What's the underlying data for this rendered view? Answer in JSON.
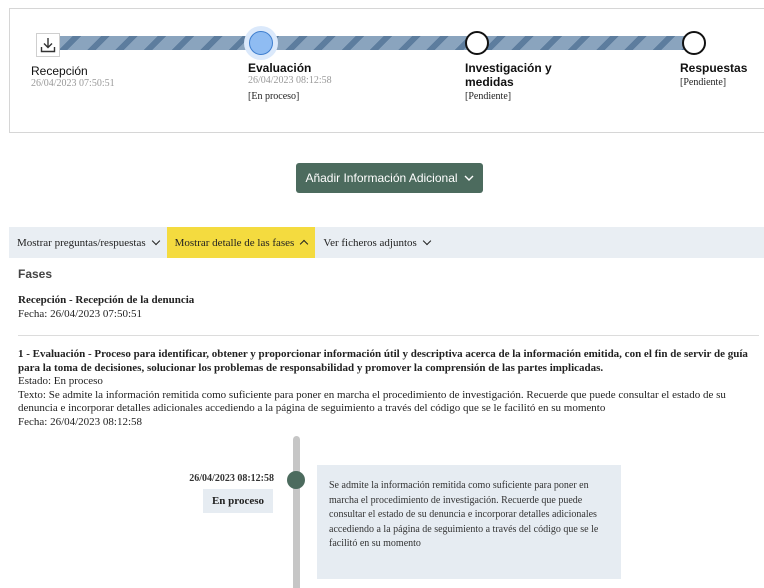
{
  "progress": {
    "steps": [
      {
        "title": "Recepción",
        "date": "26/04/2023 07:50:51",
        "status": ""
      },
      {
        "title": "Evaluación",
        "date": "26/04/2023 08:12:58",
        "status": "[En proceso]"
      },
      {
        "title_line1": "Investigación y",
        "title_line2": "medidas",
        "status": "[Pendiente]"
      },
      {
        "title": "Respuestas",
        "status": "[Pendiente]"
      }
    ],
    "icon": "download-tray-icon",
    "colors": {
      "active": "#8fbcf2",
      "track": "#8aa4be"
    }
  },
  "add_info_button": {
    "label": "Añadir Información Adicional",
    "icon": "chevron-down-icon",
    "color": "#4c6b5e"
  },
  "tabs": [
    {
      "label": "Mostrar preguntas/respuestas",
      "icon": "chevron-down-icon"
    },
    {
      "label": "Mostrar detalle de las fases",
      "icon": "chevron-up-icon",
      "active": true
    },
    {
      "label": "Ver ficheros adjuntos",
      "icon": "chevron-down-icon"
    }
  ],
  "phases": {
    "title": "Fases",
    "reception": {
      "heading": "Recepción - Recepción de la denuncia",
      "date": "Fecha: 26/04/2023 07:50:51"
    },
    "evaluation": {
      "heading": "1 - Evaluación - Proceso para identificar, obtener y proporcionar información útil y descriptiva acerca de la información emitida, con el fin de servir de guía para la toma de decisiones, solucionar los problemas de responsabilidad y promover la comprensión de las partes implicadas.",
      "state": "Estado: En proceso",
      "text": "Texto: Se admite la información remitida como suficiente para poner en marcha el procedimiento de investigación. Recuerde que puede consultar el estado de su denuncia e incorporar detalles adicionales accediendo a la página de seguimiento a través del código que se le facilitó en su momento",
      "date": "Fecha: 26/04/2023 08:12:58"
    }
  },
  "timeline": {
    "date": "26/04/2023 08:12:58",
    "badge": "En proceso",
    "message": "Se admite la información remitida como suficiente para poner en marcha el procedimiento de investigación. Recuerde que puede consultar el estado de su denuncia e incorporar detalles adicionales accediendo a la página de seguimiento a través del código que se le facilitó en su momento"
  }
}
